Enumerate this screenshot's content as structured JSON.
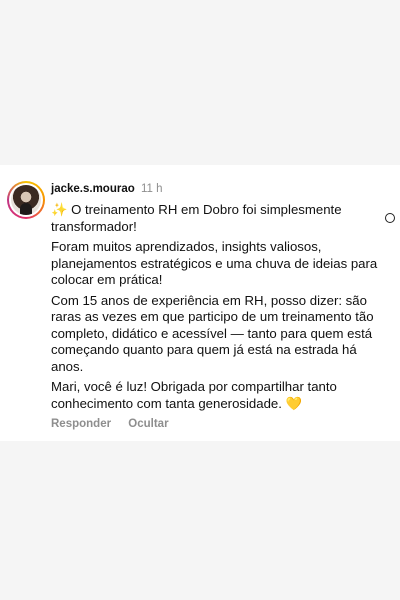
{
  "comment": {
    "username": "jacke.s.mourao",
    "time": "11 h",
    "paragraphs": [
      "✨ O treinamento RH em Dobro foi simplesmente transformador!",
      "Foram muitos aprendizados, insights valiosos, planejamentos estratégicos e uma chuva de ideias para colocar em prática!",
      "Com 15 anos de experiência em RH, posso dizer: são raras as vezes em que participo de um treinamento tão completo, didático e acessível — tanto para quem está começando quanto para quem já está na estrada há anos.",
      "Mari, você é luz! Obrigada por compartilhar tanto conhecimento com tanta generosidade. 💛"
    ],
    "reply_label": "Responder",
    "hide_label": "Ocultar"
  }
}
